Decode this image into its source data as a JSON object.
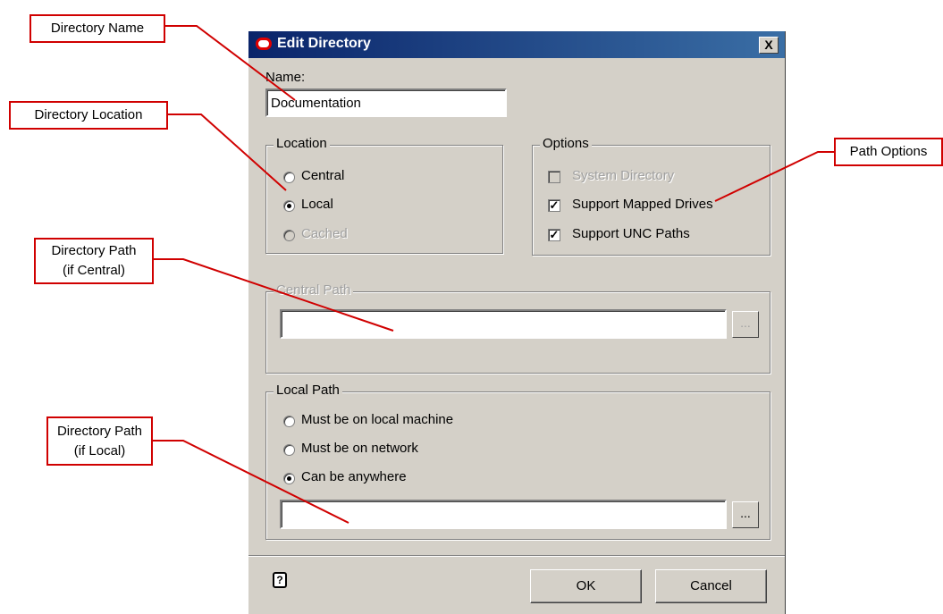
{
  "dialog": {
    "title": "Edit Directory",
    "close_symbol": "X",
    "name_label": "Name:",
    "name_value": "Documentation",
    "location": {
      "title": "Location",
      "options": [
        {
          "label": "Central",
          "selected": false,
          "enabled": true
        },
        {
          "label": "Local",
          "selected": true,
          "enabled": true
        },
        {
          "label": "Cached",
          "selected": false,
          "enabled": false
        }
      ]
    },
    "options": {
      "title": "Options",
      "items": [
        {
          "label": "System Directory",
          "checked": false,
          "enabled": false
        },
        {
          "label": "Support Mapped Drives",
          "checked": true,
          "enabled": true
        },
        {
          "label": "Support UNC Paths",
          "checked": true,
          "enabled": true
        }
      ]
    },
    "central_path": {
      "title": "Central Path",
      "value": "",
      "browse_label": "...",
      "enabled": false
    },
    "local_path": {
      "title": "Local Path",
      "options": [
        {
          "label": "Must be on local machine",
          "selected": false
        },
        {
          "label": "Must be on network",
          "selected": false
        },
        {
          "label": "Can be anywhere",
          "selected": true
        }
      ],
      "value": "",
      "browse_label": "..."
    },
    "help_symbol": "?",
    "ok_label": "OK",
    "cancel_label": "Cancel"
  },
  "callouts": {
    "directory_name": "Directory Name",
    "directory_location": "Directory Location",
    "directory_path_central": "Directory Path\n(if Central)",
    "directory_path_local": "Directory Path\n(if Local)",
    "path_options": "Path Options"
  },
  "colors": {
    "callout_border": "#d00000",
    "dialog_bg": "#d4d0c8",
    "titlebar_start": "#0a246a",
    "titlebar_end": "#3a6ea5",
    "disabled_text": "#a0a0a0"
  }
}
